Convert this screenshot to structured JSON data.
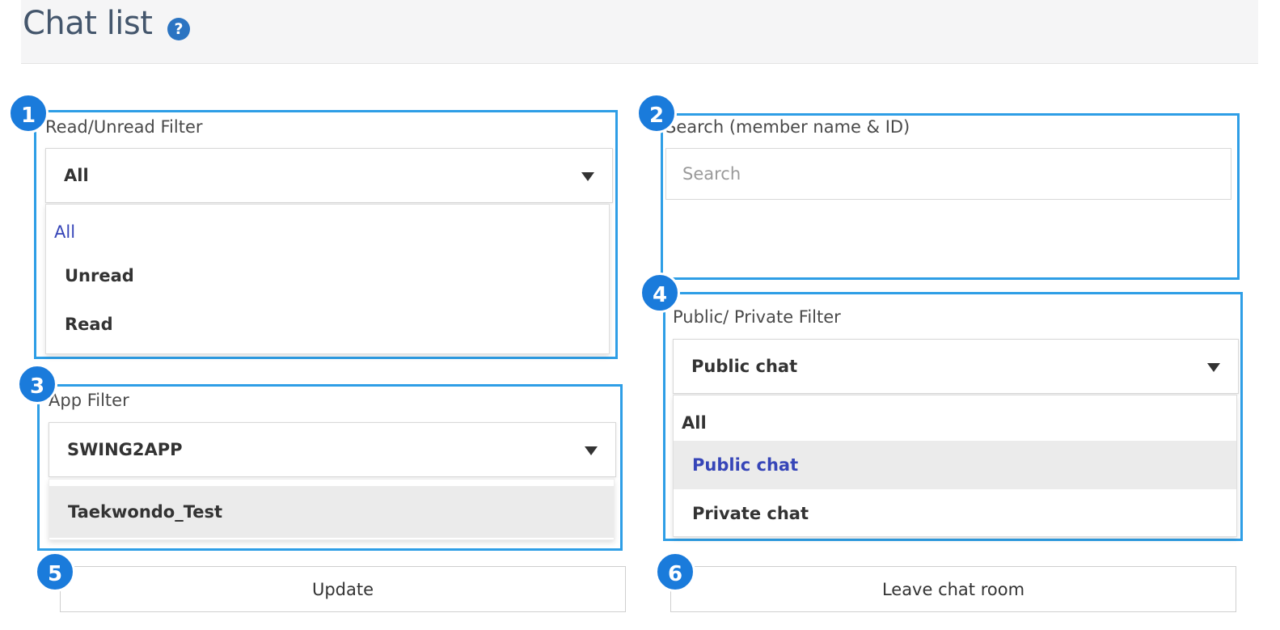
{
  "header": {
    "title": "Chat list",
    "help_glyph": "?"
  },
  "badges": [
    "1",
    "2",
    "3",
    "4",
    "5",
    "6"
  ],
  "read_filter": {
    "label": "Read/Unread Filter",
    "selected": "All",
    "options": [
      "All",
      "Unread",
      "Read"
    ]
  },
  "search": {
    "label": "Search (member name & ID)",
    "placeholder": "Search",
    "value": ""
  },
  "app_filter": {
    "label": "App Filter",
    "selected": "SWING2APP",
    "options": [
      "Taekwondo_Test"
    ]
  },
  "privacy_filter": {
    "label": "Public/ Private Filter",
    "selected": "Public chat",
    "options": [
      "All",
      "Public chat",
      "Private chat"
    ]
  },
  "buttons": {
    "update": "Update",
    "leave": "Leave chat room"
  },
  "colors": {
    "outline": "#2e9ee6",
    "badge": "#1a7bdb",
    "selected_option": "#3645b8",
    "title": "#44566c"
  }
}
